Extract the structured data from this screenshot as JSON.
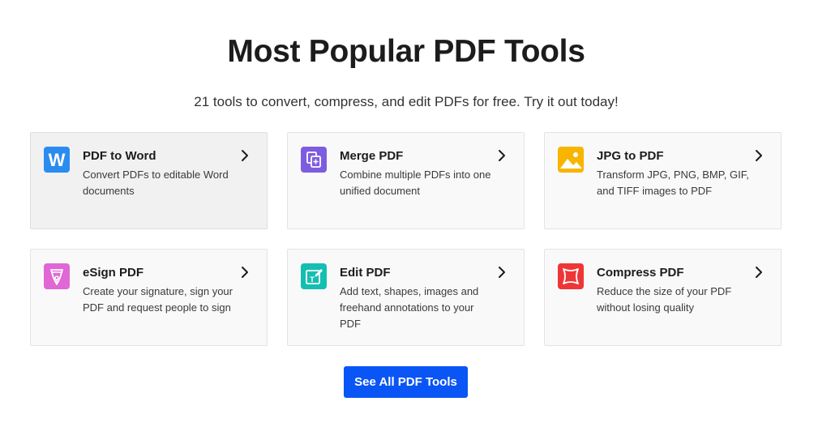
{
  "header": {
    "title": "Most Popular PDF Tools",
    "subtitle": "21 tools to convert, compress, and edit PDFs for free. Try it out today!"
  },
  "tools": [
    {
      "title": "PDF to Word",
      "description": "Convert PDFs to editable Word documents",
      "icon": "word-icon",
      "color": "#2b8cf0"
    },
    {
      "title": "Merge PDF",
      "description": "Combine multiple PDFs into one unified document",
      "icon": "merge-icon",
      "color": "#7e5ce0"
    },
    {
      "title": "JPG to PDF",
      "description": "Transform JPG, PNG, BMP, GIF, and TIFF images to PDF",
      "icon": "image-icon",
      "color": "#f7b500"
    },
    {
      "title": "eSign PDF",
      "description": "Create your signature, sign your PDF and request people to sign",
      "icon": "pen-nib-icon",
      "color": "#e067d5"
    },
    {
      "title": "Edit PDF",
      "description": "Add text, shapes, images and freehand annotations to your PDF",
      "icon": "edit-icon",
      "color": "#14bfb2"
    },
    {
      "title": "Compress PDF",
      "description": "Reduce the size of your PDF without losing quality",
      "icon": "compress-icon",
      "color": "#ef3636"
    }
  ],
  "cta": {
    "label": "See All PDF Tools",
    "color": "#0a55f5"
  }
}
